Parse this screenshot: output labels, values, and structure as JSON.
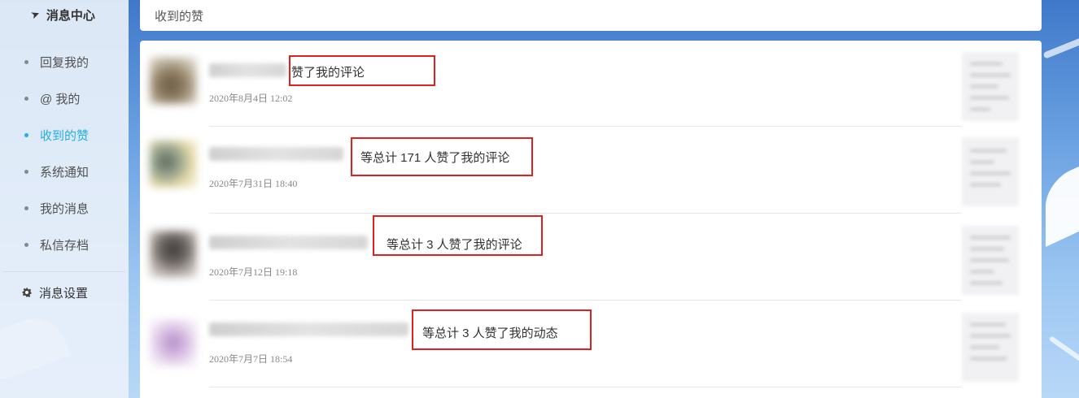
{
  "sidebar": {
    "title": "消息中心",
    "items": [
      {
        "label": "回复我的",
        "active": false
      },
      {
        "label": "@ 我的",
        "active": false
      },
      {
        "label": "收到的赞",
        "active": true
      },
      {
        "label": "系统通知",
        "active": false
      },
      {
        "label": "我的消息",
        "active": false
      },
      {
        "label": "私信存档",
        "active": false
      }
    ],
    "settings_label": "消息设置"
  },
  "header": {
    "title": "收到的赞"
  },
  "likes": [
    {
      "action": "赞了我的评论",
      "time": "2020年8月4日 12:02"
    },
    {
      "action": "等总计 171 人赞了我的评论",
      "time": "2020年7月31日 18:40"
    },
    {
      "action": "等总计 3 人赞了我的评论",
      "time": "2020年7月12日 19:18"
    },
    {
      "action": "等总计 3 人赞了我的动态",
      "time": "2020年7月7日 18:54"
    }
  ],
  "colors": {
    "accent": "#23ade5",
    "highlight_box": "#e02020"
  }
}
